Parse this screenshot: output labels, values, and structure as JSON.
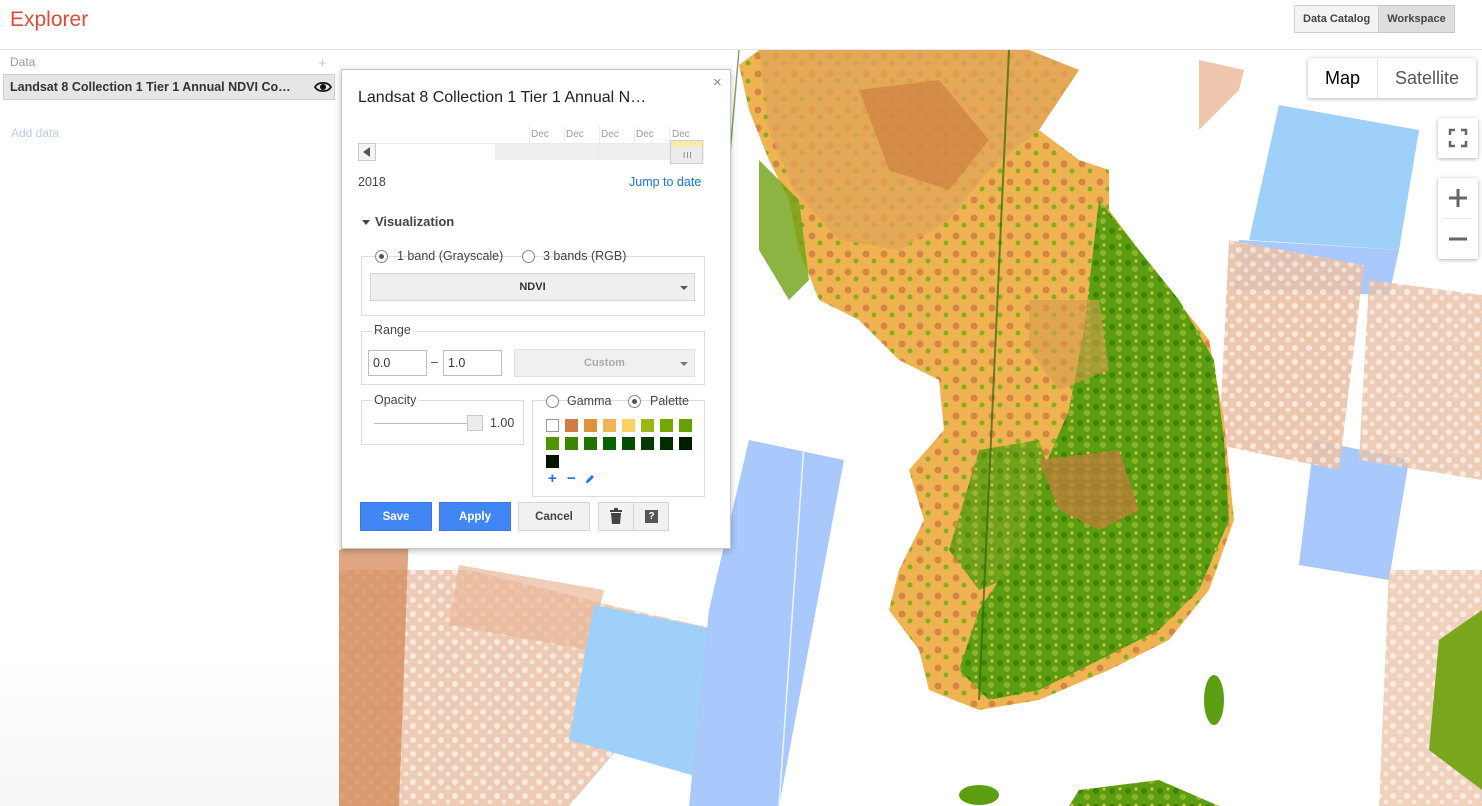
{
  "app": {
    "title": "Explorer"
  },
  "topbar": {
    "buttons": [
      "Data Catalog",
      "Workspace"
    ],
    "active": "Workspace"
  },
  "sidebar": {
    "header": "Data",
    "add_symbol": "+",
    "layer": {
      "name": "Landsat 8 Collection 1 Tier 1 Annual NDVI Co…",
      "visible": true
    },
    "add_data": "Add data"
  },
  "map": {
    "type_buttons": {
      "map": "Map",
      "satellite": "Satellite"
    },
    "zoom_in": "+",
    "zoom_out": "−"
  },
  "panel": {
    "close": "×",
    "title": "Landsat 8 Collection 1 Tier 1 Annual N…",
    "timeline": {
      "labels": [
        "Dec",
        "Dec",
        "Dec",
        "Dec",
        "Dec"
      ],
      "handle": "III"
    },
    "year": "2018",
    "jump_to_date": "Jump to date",
    "visualization": {
      "heading": "Visualization",
      "band_modes": [
        "1 band (Grayscale)",
        "3 bands (RGB)"
      ],
      "selected_band_mode": "1 band (Grayscale)",
      "band": "NDVI",
      "range": {
        "label": "Range",
        "min": "0.0",
        "separator": "–",
        "max": "1.0",
        "preset": "Custom"
      },
      "opacity": {
        "label": "Opacity",
        "value": "1.00"
      },
      "color_modes": [
        "Gamma",
        "Palette"
      ],
      "selected_color_mode": "Palette",
      "palette": [
        "#FFFFFF",
        "#CE7E45",
        "#DF923D",
        "#F1B555",
        "#FCD163",
        "#99B718",
        "#74A901",
        "#66A000",
        "#529400",
        "#3E8601",
        "#207401",
        "#056201",
        "#004C00",
        "#023B01",
        "#012E01",
        "#011D01",
        "#011301"
      ],
      "palette_actions": {
        "add": "+",
        "remove": "−"
      }
    },
    "buttons": {
      "save": "Save",
      "apply": "Apply",
      "cancel": "Cancel",
      "delete_icon": "trash-icon",
      "help": "?"
    }
  },
  "colors": {
    "accent_red": "#dd4b39",
    "primary_blue": "#4285f4",
    "link_blue": "#1a73e8",
    "water": "#9fd0fa"
  }
}
